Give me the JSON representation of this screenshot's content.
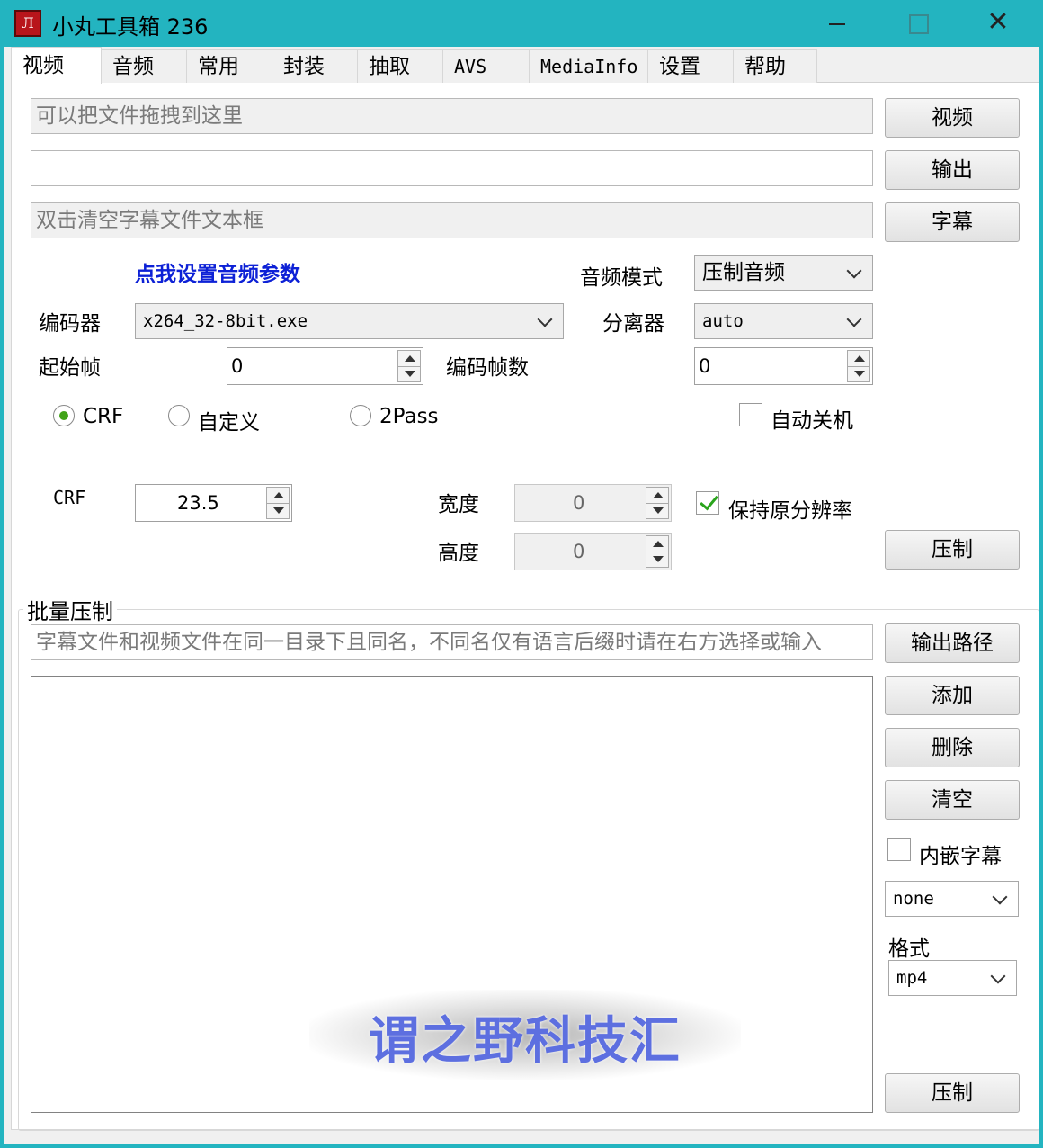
{
  "window": {
    "title": "小丸工具箱 236",
    "icon_glyph": "Л",
    "close_glyph": "✕",
    "accent_color": "#23b4c0"
  },
  "tabs": [
    {
      "label": "视频",
      "active": true
    },
    {
      "label": "音频"
    },
    {
      "label": "常用"
    },
    {
      "label": "封装"
    },
    {
      "label": "抽取"
    },
    {
      "label": "AVS"
    },
    {
      "label": "MediaInfo"
    },
    {
      "label": "设置"
    },
    {
      "label": "帮助"
    }
  ],
  "inputs": {
    "video_placeholder": "可以把文件拖拽到这里",
    "output_value": "",
    "subtitle_placeholder": "双击清空字幕文件文本框"
  },
  "buttons": {
    "video": "视频",
    "output": "输出",
    "subtitle": "字幕",
    "compress": "压制",
    "output_path": "输出路径",
    "add": "添加",
    "delete": "删除",
    "clear": "清空",
    "batch_compress": "压制"
  },
  "audio_settings_link": "点我设置音频参数",
  "audio_mode": {
    "label": "音频模式",
    "value": "压制音频"
  },
  "encoder": {
    "label": "编码器",
    "value": "x264_32-8bit.exe"
  },
  "splitter": {
    "label": "分离器",
    "value": "auto"
  },
  "start_frame": {
    "label": "起始帧",
    "value": "0"
  },
  "encode_frames": {
    "label": "编码帧数",
    "value": "0"
  },
  "rate_modes": [
    {
      "label": "CRF",
      "selected": true
    },
    {
      "label": "自定义",
      "selected": false
    },
    {
      "label": "2Pass",
      "selected": false
    }
  ],
  "auto_shutdown": {
    "label": "自动关机",
    "checked": false
  },
  "crf": {
    "label": "CRF",
    "value": "23.5"
  },
  "width": {
    "label": "宽度",
    "value": "0"
  },
  "height": {
    "label": "高度",
    "value": "0"
  },
  "keep_resolution": {
    "label": "保持原分辨率",
    "checked": true
  },
  "batch": {
    "title": "批量压制",
    "hint": "字幕文件和视频文件在同一目录下且同名，不同名仅有语言后缀时请在右方选择或输入",
    "embed_subtitle": {
      "label": "内嵌字幕",
      "checked": false
    },
    "subtitle_lang": "none",
    "format_label": "格式",
    "format_value": "mp4"
  },
  "watermark": "谓之野科技汇"
}
